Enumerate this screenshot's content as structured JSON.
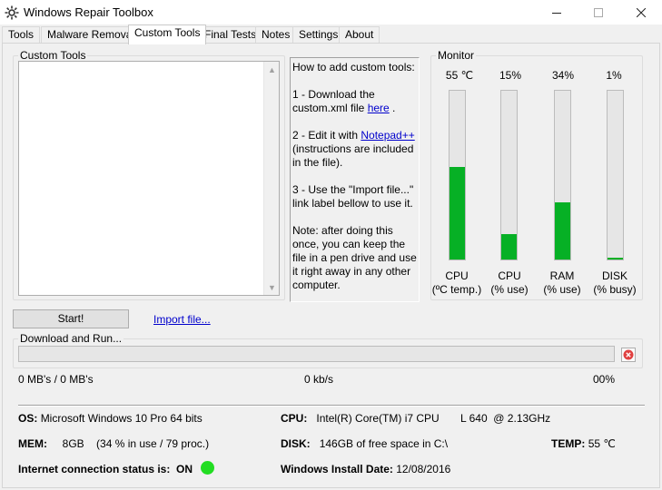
{
  "window": {
    "title": "Windows Repair Toolbox"
  },
  "tabs": [
    {
      "label": "Tools"
    },
    {
      "label": "Malware Removal"
    },
    {
      "label": "Custom Tools"
    },
    {
      "label": "Final Tests"
    },
    {
      "label": "Notes"
    },
    {
      "label": "Settings"
    },
    {
      "label": "About"
    }
  ],
  "custom_tools": {
    "group_label": "Custom Tools",
    "instructions": {
      "heading": "How to add custom tools:",
      "step1_text": "1 - Download the custom.xml file ",
      "step1_link": "here",
      "step1_suffix": " .",
      "step2_text": "2 - Edit it with ",
      "step2_link": "Notepad++",
      "step2_suffix": " (instructions are included in the file).",
      "step3_text": "3 - Use the \"Import file...\" link label bellow to use it.",
      "note_text": "Note: after doing this once, you can keep the file in a pen drive and use it right away in any other computer."
    },
    "start_button": "Start!",
    "import_link": "Import file..."
  },
  "monitor": {
    "group_label": "Monitor",
    "gauges": [
      {
        "value": "55 ℃",
        "level": 55,
        "label_line1": "CPU",
        "label_line2": "(ºC temp.)"
      },
      {
        "value": "15%",
        "level": 15,
        "label_line1": "CPU",
        "label_line2": "(% use)"
      },
      {
        "value": "34%",
        "level": 34,
        "label_line1": "RAM",
        "label_line2": "(% use)"
      },
      {
        "value": "1%",
        "level": 1,
        "label_line1": "DISK",
        "label_line2": "(% busy)"
      }
    ],
    "bar_color": "#06b025"
  },
  "download": {
    "group_label": "Download and Run...",
    "progress": 0,
    "transferred": "0 MB's / 0 MB's",
    "speed": "0 kb/s",
    "percent": "00%"
  },
  "system": {
    "os_label": "OS:",
    "os_value": "Microsoft Windows 10 Pro 64 bits",
    "cpu_label": "CPU:",
    "cpu_value": "Intel(R) Core(TM) i7 CPU       L 640  @ 2.13GHz",
    "mem_label": "MEM:",
    "mem_value": "8GB    (34 % in use / 79 proc.)",
    "disk_label": "DISK:",
    "disk_value": "146GB of free space in C:\\",
    "temp_label": "TEMP:",
    "temp_value": "55 ℃",
    "internet_label": "Internet connection status is:",
    "internet_value": "ON",
    "install_label": "Windows Install Date:",
    "install_value": "12/08/2016",
    "status_color": "#22dd22"
  }
}
